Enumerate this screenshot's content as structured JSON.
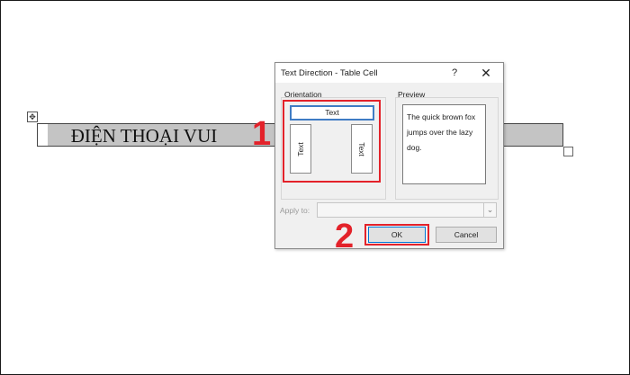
{
  "document": {
    "table_cell_text": "ĐIỆN THOẠI VUI",
    "move_handle_glyph": "✥"
  },
  "annotations": {
    "step_1": "1",
    "step_2": "2",
    "highlight_color": "#e3222a"
  },
  "dialog": {
    "title": "Text Direction - Table Cell",
    "help_label": "?",
    "close_label": "✕",
    "orientation_label": "Orientation",
    "orientation_options": [
      {
        "label": "Text",
        "direction": "horizontal",
        "selected": true
      },
      {
        "label": "Text",
        "direction": "vertical-up",
        "selected": false
      },
      {
        "label": "Text",
        "direction": "vertical-down",
        "selected": false
      }
    ],
    "preview_label": "Preview",
    "preview_text": "The quick brown fox jumps over the lazy dog.",
    "apply_to_label": "Apply to:",
    "apply_to_value": "",
    "ok_label": "OK",
    "cancel_label": "Cancel",
    "accent_color": "#0078d7"
  }
}
